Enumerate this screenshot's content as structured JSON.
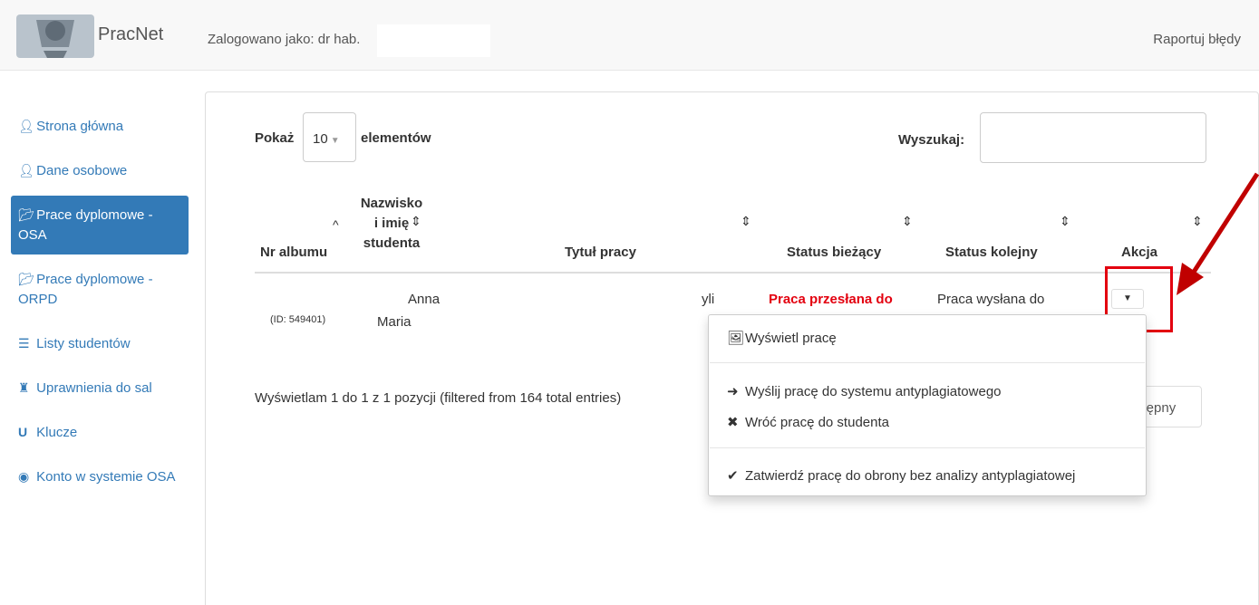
{
  "header": {
    "brand": "PracNet",
    "logged_in": "Zalogowano jako: dr hab.",
    "report": "Raportuj błędy"
  },
  "sidebar": {
    "items": [
      {
        "label": "Strona główna",
        "icon": "user-icon"
      },
      {
        "label": "Dane osobowe",
        "icon": "user-icon"
      },
      {
        "label": "Prace dyplomowe - OSA",
        "icon": "folder-open-icon",
        "active": true
      },
      {
        "label": "Prace dyplomowe - ORPD",
        "icon": "folder-open-icon"
      },
      {
        "label": "Listy studentów",
        "icon": "list-icon"
      },
      {
        "label": "Uprawnienia do sal",
        "icon": "tower-icon"
      },
      {
        "label": "Klucze",
        "icon": "magnet-icon"
      },
      {
        "label": "Konto w systemie OSA",
        "icon": "eye-icon"
      }
    ]
  },
  "controls": {
    "show_label": "Pokaż",
    "page_length": "10",
    "elements_label": "elementów",
    "search_label": "Wyszukaj:",
    "search_value": ""
  },
  "table": {
    "headers": [
      "Nr albumu",
      "Nazwisko i imię studenta",
      "Tytuł pracy",
      "Status bieżący",
      "Status kolejny",
      "Akcja"
    ],
    "rows": [
      {
        "album": "(ID: 549401)",
        "name_first": "Anna",
        "name_second": "Maria",
        "title_fragment": "yli",
        "status_current": "Praca przesłana do",
        "status_next": "Praca wysłana do"
      }
    ]
  },
  "footer": {
    "info": "Wyświetlam 1 do 1 z 1 pozycji (filtered from 164 total entries)",
    "next": "stępny"
  },
  "dropdown": {
    "items": [
      {
        "label": "Wyświetl pracę",
        "icon": "image-icon"
      },
      {
        "label": "Wyślij pracę do systemu antyplagiatowego",
        "icon": "share-arrow-icon"
      },
      {
        "label": "Wróć pracę do studenta",
        "icon": "remove-icon"
      },
      {
        "label": "Zatwierdź pracę do obrony bez analizy antyplagiatowej",
        "icon": "check-icon"
      }
    ]
  },
  "colors": {
    "primary": "#337ab7",
    "status_red": "#e3000f",
    "highlight_red": "#e3000f"
  }
}
